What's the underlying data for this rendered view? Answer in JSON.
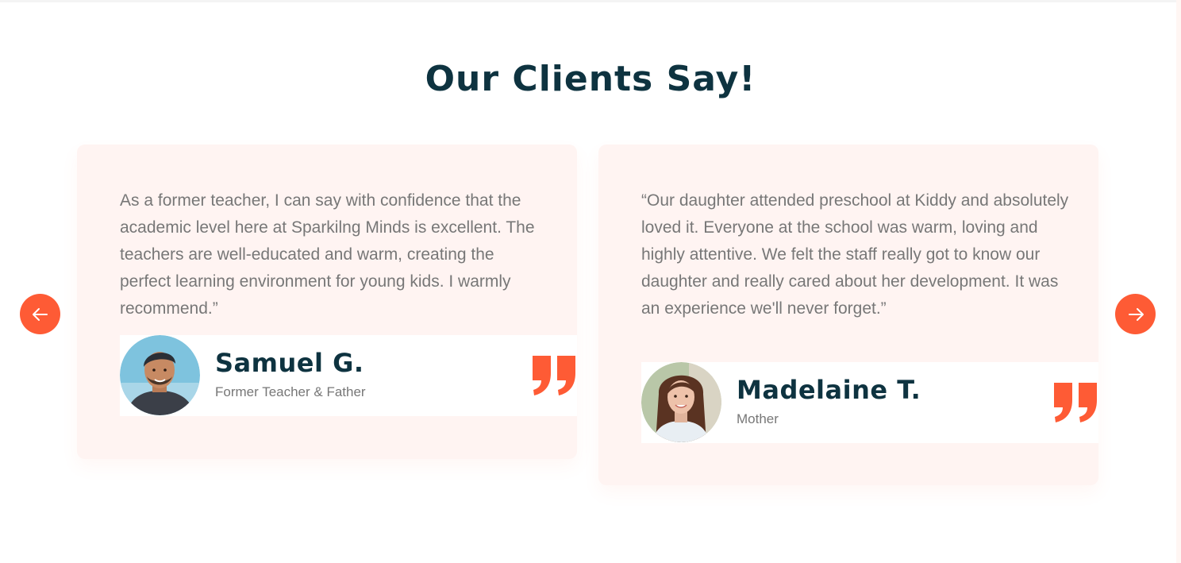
{
  "section": {
    "title": "Our Clients Say!"
  },
  "colors": {
    "accent": "#fe5b35",
    "heading": "#0e3340",
    "card_bg": "#fff4f2",
    "body_text": "#777777"
  },
  "navigation": {
    "prev_icon": "arrow-left-icon",
    "next_icon": "arrow-right-icon"
  },
  "testimonials": [
    {
      "quote": "As a former teacher, I can say with confidence that the academic level here at Sparkilng Minds is excellent. The teachers are well-educated and warm, creating the perfect learning environment for young kids. I warmly recommend.”",
      "name": "Samuel G.",
      "role": "Former Teacher & Father",
      "icon": "quote-icon"
    },
    {
      "quote": "“Our daughter attended preschool at Kiddy and absolutely loved it. Everyone at the school was warm, loving and highly attentive. We felt the staff really got to know our daughter and really cared about her development. It was an experience we'll never forget.”",
      "name": "Madelaine T.",
      "role": "Mother",
      "icon": "quote-icon"
    }
  ]
}
